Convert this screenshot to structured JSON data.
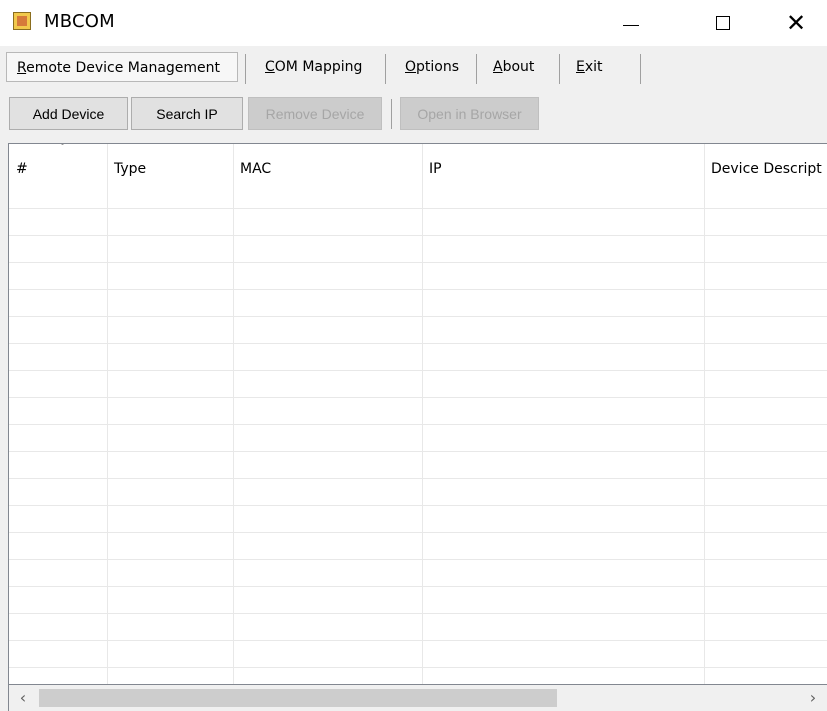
{
  "window": {
    "title": "MBCOM",
    "icon": "app-icon",
    "minimize_glyph": "—",
    "close_glyph": "✕"
  },
  "menu": {
    "remote_device_management": {
      "mnemonic": "R",
      "rest": "emote Device Management"
    },
    "com_mapping": {
      "mnemonic": "C",
      "rest": "OM Mapping"
    },
    "options": {
      "mnemonic": "O",
      "rest": "ptions"
    },
    "about": {
      "mnemonic": "A",
      "rest": "bout"
    },
    "exit": {
      "mnemonic": "E",
      "rest": "xit"
    }
  },
  "toolbar": {
    "add_device": "Add Device",
    "search_ip": "Search IP",
    "remove_device": "Remove Device",
    "open_in_browser": "Open in Browser"
  },
  "table": {
    "columns": [
      "#",
      "Type",
      "MAC",
      "IP",
      "Device Descript"
    ],
    "sort_indicator": "﹀",
    "rows": []
  },
  "scrollbar": {
    "left_arrow": "‹",
    "right_arrow": "›"
  },
  "colors": {
    "background": "#f0f0f0",
    "grid": "#e8e8e8",
    "disabled_text": "#a6a6a6"
  }
}
